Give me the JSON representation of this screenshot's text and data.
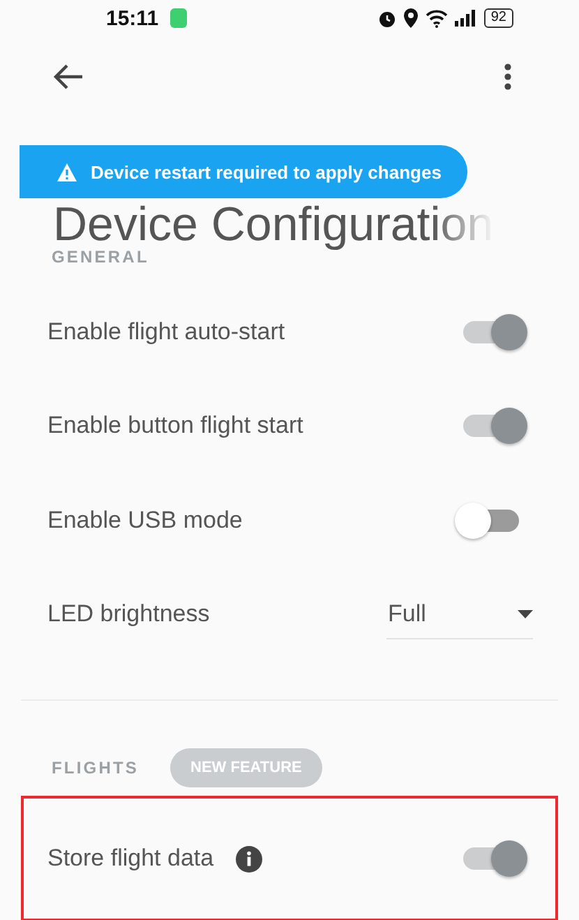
{
  "status_bar": {
    "time": "15:11",
    "battery": "92"
  },
  "app_bar": {
    "title": "Device Configuration"
  },
  "banner": {
    "text": "Device restart required to apply changes"
  },
  "sections": [
    {
      "title": "GENERAL",
      "highlighted": false,
      "items": [
        {
          "kind": "toggle",
          "label": "Enable flight auto-start",
          "on": true,
          "info": false
        },
        {
          "kind": "toggle",
          "label": "Enable button flight start",
          "on": true,
          "info": false
        },
        {
          "kind": "toggle",
          "label": "Enable USB mode",
          "on": false,
          "info": false
        },
        {
          "kind": "select",
          "label": "LED brightness",
          "value": "Full"
        }
      ]
    },
    {
      "title": "FLIGHTS",
      "badge": "NEW FEATURE",
      "highlighted": true,
      "items": [
        {
          "kind": "toggle",
          "label": "Store flight data",
          "on": true,
          "info": true
        }
      ]
    }
  ]
}
